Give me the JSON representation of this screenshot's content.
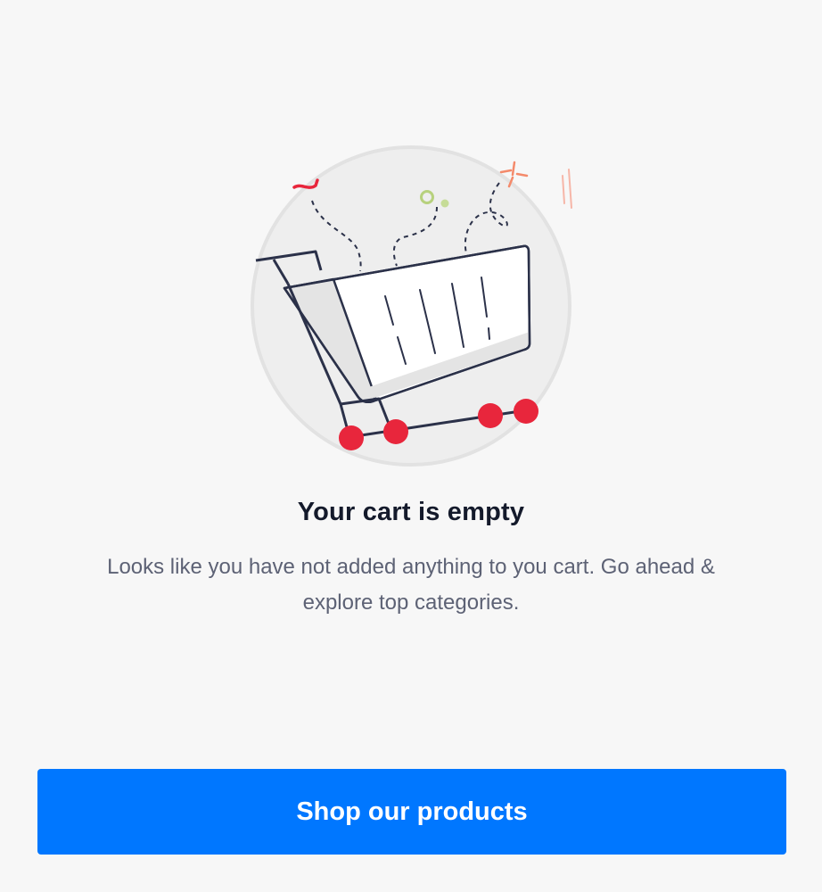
{
  "empty_state": {
    "illustration_icon": "empty-shopping-cart-illustration",
    "title": "Your cart is empty",
    "message": "Looks like you have not added anything to you cart. Go ahead & explore top categories."
  },
  "cta": {
    "label": "Shop our products"
  },
  "colors": {
    "background": "#f7f7f7",
    "primary": "#0077ff",
    "wheel": "#e8263c",
    "outline": "#2b3149",
    "title": "#141a2b",
    "message": "#5d6275"
  }
}
